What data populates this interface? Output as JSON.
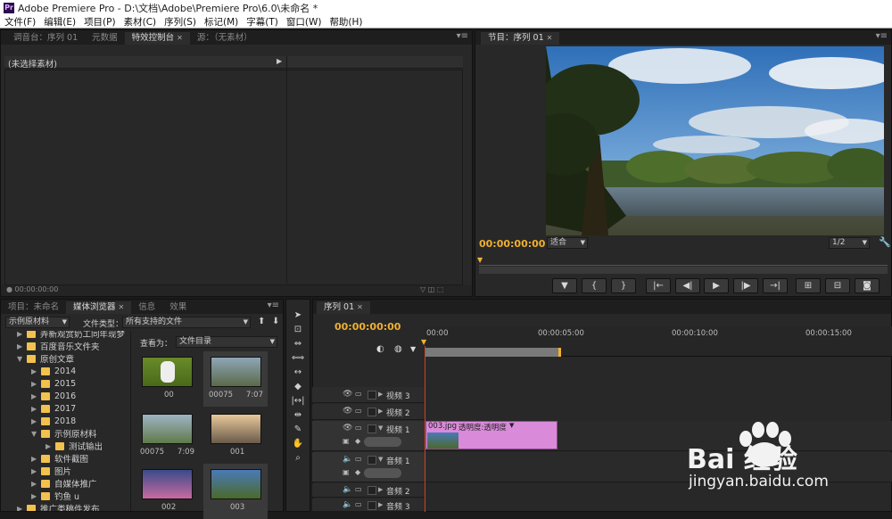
{
  "window": {
    "title": "Adobe Premiere Pro - D:\\文档\\Adobe\\Premiere Pro\\6.0\\未命名 *",
    "logo": "Pr"
  },
  "menu": [
    "文件(F)",
    "编辑(E)",
    "项目(P)",
    "素材(C)",
    "序列(S)",
    "标记(M)",
    "字幕(T)",
    "窗口(W)",
    "帮助(H)"
  ],
  "source_panel": {
    "tabs": [
      "调音台：序列 01",
      "元数据",
      "特效控制台",
      "源：（无素材）"
    ],
    "active_tab": 2,
    "no_clip": "(未选择素材)",
    "timecode": "00:00:00:00"
  },
  "program_panel": {
    "tab": "节目：序列 01",
    "timecode": "00:00:00:00",
    "fit": "适合",
    "resolution": "1/2"
  },
  "project_panel": {
    "tabs": [
      "项目：未命名",
      "媒体浏览器",
      "信息",
      "效果"
    ],
    "active_tab": 1,
    "location": "示例原材料",
    "file_type_label": "文件类型：",
    "file_type": "所有支持的文件",
    "view_as_label": "查看为：",
    "view_as": "文件目录",
    "tree": [
      {
        "label": "弄新观赏奶工同年现梦",
        "depth": 1,
        "open": false
      },
      {
        "label": "百度音乐文件夹",
        "depth": 1,
        "open": false
      },
      {
        "label": "原创文章",
        "depth": 1,
        "open": true
      },
      {
        "label": "2014",
        "depth": 2,
        "open": false
      },
      {
        "label": "2015",
        "depth": 2,
        "open": false
      },
      {
        "label": "2016",
        "depth": 2,
        "open": false
      },
      {
        "label": "2017",
        "depth": 2,
        "open": false
      },
      {
        "label": "2018",
        "depth": 2,
        "open": false
      },
      {
        "label": "示例原材料",
        "depth": 2,
        "open": true
      },
      {
        "label": "测试输出",
        "depth": 3,
        "open": false
      },
      {
        "label": "软件截图",
        "depth": 2,
        "open": false
      },
      {
        "label": "图片",
        "depth": 2,
        "open": false
      },
      {
        "label": "自媒体推广",
        "depth": 2,
        "open": false
      },
      {
        "label": "钓鱼 u",
        "depth": 2,
        "open": false
      },
      {
        "label": "推广类稿件发布",
        "depth": 1,
        "open": false
      }
    ],
    "thumbs": [
      {
        "name": "00",
        "duration": ""
      },
      {
        "name": "00075",
        "duration": "7:07"
      },
      {
        "name": "00075",
        "duration": "7:09"
      },
      {
        "name": "001",
        "duration": ""
      },
      {
        "name": "002",
        "duration": ""
      },
      {
        "name": "003",
        "duration": ""
      }
    ]
  },
  "timeline": {
    "tab": "序列 01",
    "timecode": "00:00:00:00",
    "ruler": [
      "00:00",
      "00:00:05:00",
      "00:00:10:00",
      "00:00:15:00"
    ],
    "tracks": [
      "视频 3",
      "视频 2",
      "视频 1",
      "音频 1",
      "音频 2",
      "音频 3"
    ],
    "clip_label": "003.jpg",
    "clip_opacity": "透明度:透明度"
  },
  "watermark": {
    "brand": "Bai 经验",
    "url": "jingyan.baidu.com"
  },
  "colors": {
    "accent": "#f0b030",
    "clip": "#d98ad9",
    "panel": "#282828"
  }
}
